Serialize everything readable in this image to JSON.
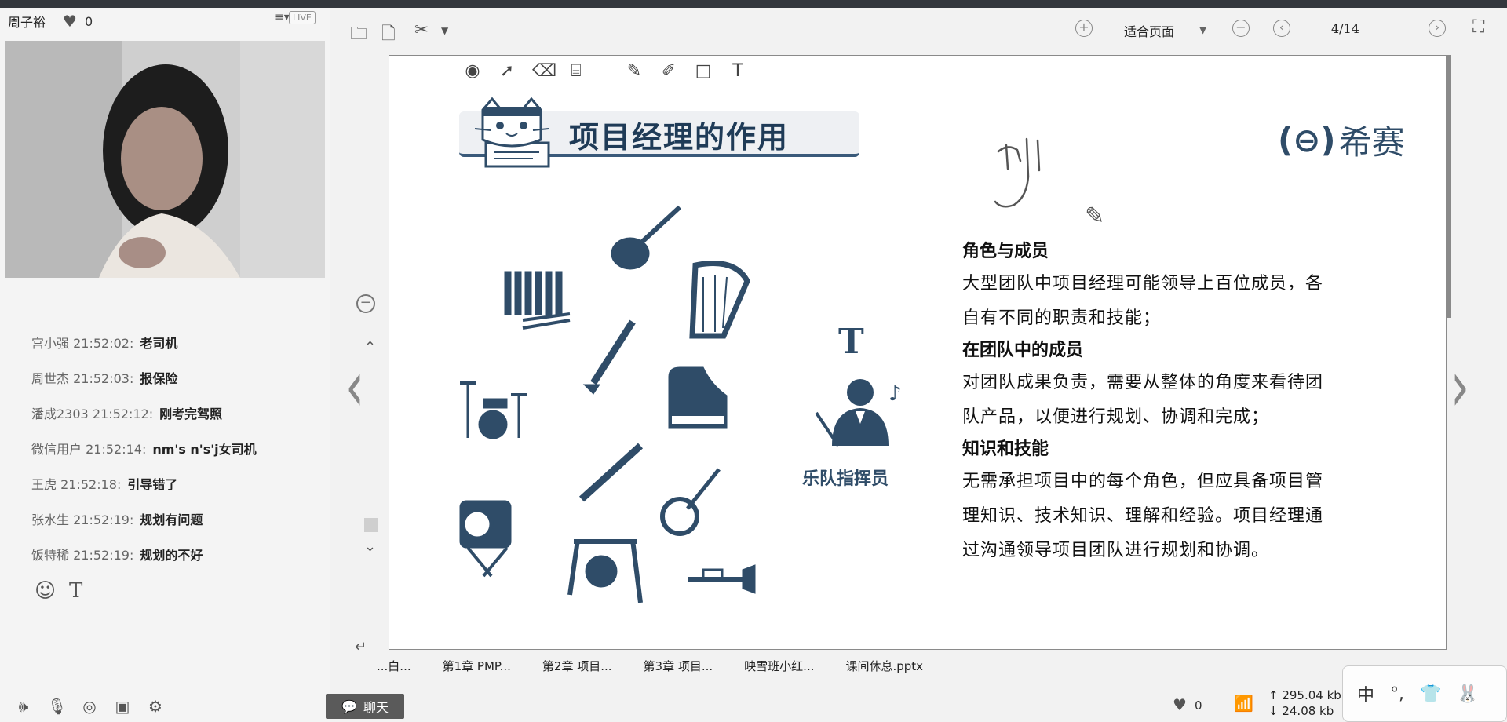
{
  "host": {
    "name": "周子裕",
    "likes": "0",
    "live_label": "LIVE"
  },
  "chat": {
    "messages": [
      {
        "user": "宫小强",
        "time": "21:52:02:",
        "text": "老司机"
      },
      {
        "user": "周世杰",
        "time": "21:52:03:",
        "text": "报保险"
      },
      {
        "user": "潘成2303",
        "time": "21:52:12:",
        "text": "刚考完驾照"
      },
      {
        "user": "微信用户",
        "time": "21:52:14:",
        "text": "nm's n's'j女司机"
      },
      {
        "user": "王虎",
        "time": "21:52:18:",
        "text": "引导错了"
      },
      {
        "user": "张水生",
        "time": "21:52:19:",
        "text": "规划有问题"
      },
      {
        "user": "饭特稀",
        "time": "21:52:19:",
        "text": "规划的不好"
      }
    ],
    "chat_button_label": "聊天"
  },
  "viewer": {
    "zoom_label": "适合页面",
    "page": "4/14"
  },
  "slide": {
    "title": "项目经理的作用",
    "logo_text": "希赛",
    "conductor_label": "乐队指挥员",
    "big_t": "T",
    "sections": [
      {
        "heading": "角色与成员",
        "lines": [
          "大型团队中项目经理可能领导上百位成员，各",
          "自有不同的职责和技能；"
        ]
      },
      {
        "heading": "在团队中的成员",
        "lines": [
          "对团队成果负责，需要从整体的角度来看待团",
          "队产品，以便进行规划、协调和完成；"
        ]
      },
      {
        "heading": "知识和技能",
        "lines": [
          "无需承担项目中的每个角色，但应具备项目管",
          "理知识、技术知识、理解和经验。项目经理通",
          "过沟通领导项目团队进行规划和协调。"
        ]
      }
    ]
  },
  "file_tabs": [
    "...白...",
    "第1章 PMP...",
    "第2章 项目...",
    "第3章 项目...",
    "映雪班小红...",
    "课间休息.pptx"
  ],
  "status": {
    "likes": "0",
    "upload": "295.04 kb",
    "download": "24.08 kb"
  },
  "ime": {
    "mode": "中",
    "punct": "°,"
  },
  "colors": {
    "accent": "#2f4c68",
    "topbar": "#33373d"
  }
}
